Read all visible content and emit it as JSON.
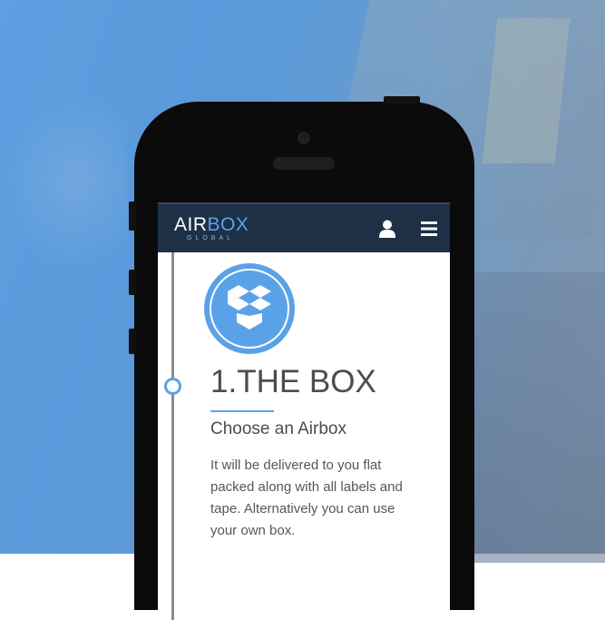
{
  "app": {
    "logo_main": "AIR",
    "logo_accent": "BOX",
    "logo_sub": "GLOBAL"
  },
  "navbar": {
    "icons": [
      "user-icon",
      "hamburger-menu-icon"
    ]
  },
  "step": {
    "icon": "open-box-icon",
    "title": "1.THE BOX",
    "subtitle": "Choose an Airbox",
    "description": "It will be delivered to you flat packed along with all labels and tape. Alternatively you can use your own box."
  },
  "colors": {
    "accent": "#5aa2e8",
    "navbar": "#1d3046",
    "text": "#4a4d52",
    "timeline": "#8c8c8c"
  }
}
